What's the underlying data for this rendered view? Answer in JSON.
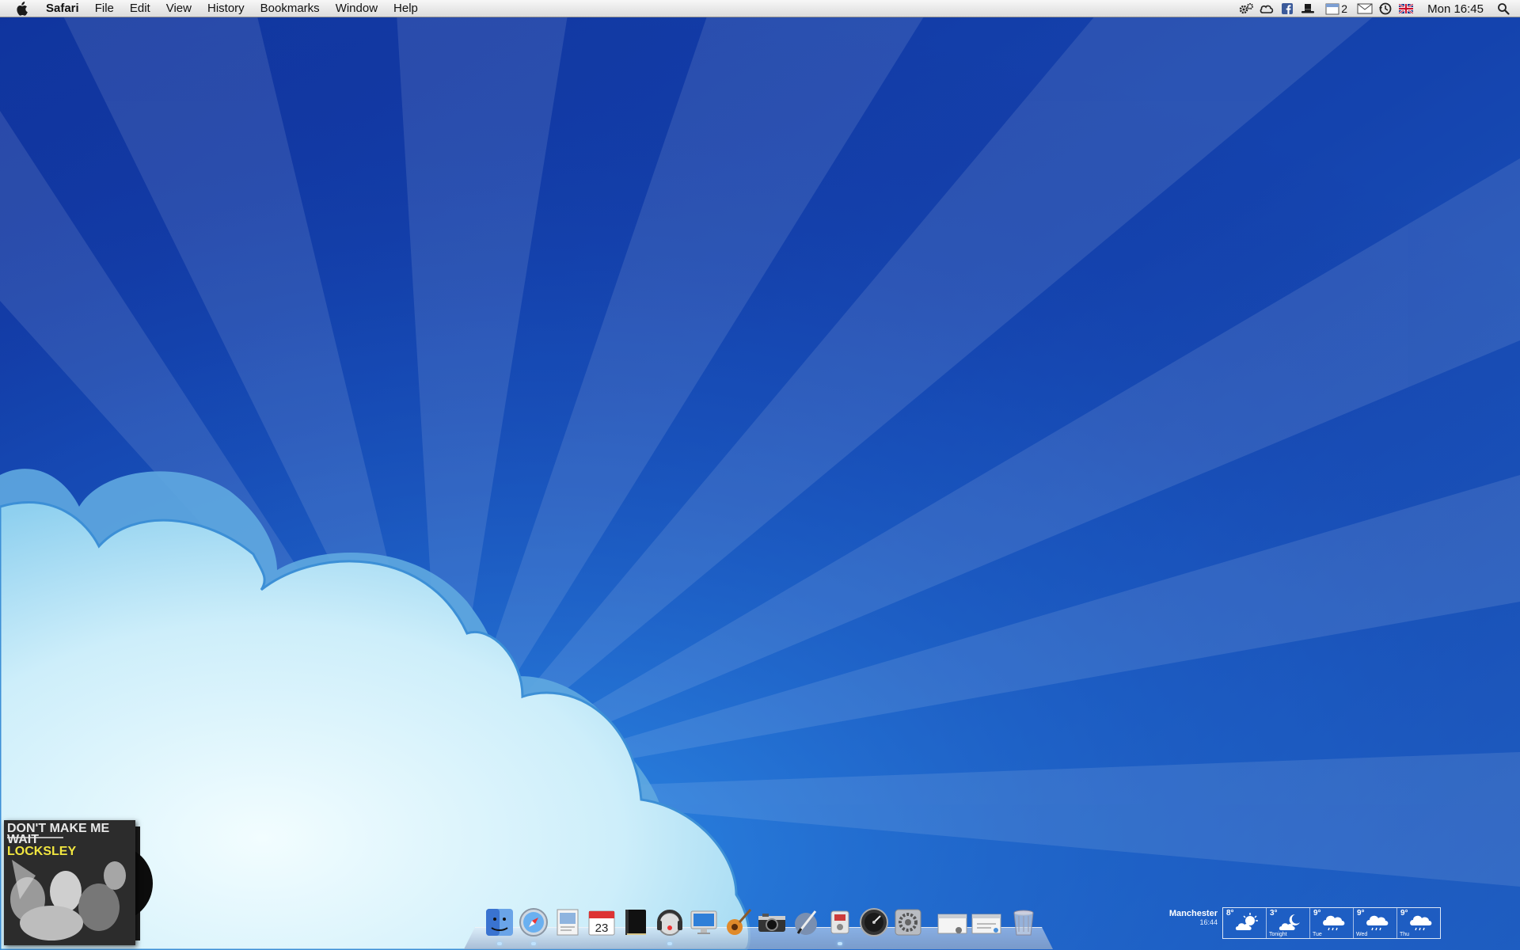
{
  "menubar": {
    "apple_icon": "apple-icon",
    "app_name": "Safari",
    "menus": [
      "File",
      "Edit",
      "View",
      "History",
      "Bookmarks",
      "Window",
      "Help"
    ],
    "extras": [
      "gears-icon",
      "cloud-icon",
      "facebook-icon",
      "hat-icon",
      "calendar-icon",
      "mail-icon",
      "time-machine-icon",
      "uk-flag-icon"
    ],
    "calendar_badge": "2",
    "clock": "Mon 16:45",
    "spotlight_icon": "spotlight-icon"
  },
  "album_widget": {
    "line1": "DON'T MAKE ME",
    "line2": "WAIT",
    "line3": "LOCKSLEY",
    "accent_color": "#f1e640"
  },
  "dock": {
    "apps": [
      "finder-icon",
      "safari-icon",
      "preview-icon",
      "ical-icon",
      "notebook-icon",
      "itunes-icon",
      "display-icon",
      "garageband-icon",
      "camera-icon",
      "pen-icon",
      "utility-icon",
      "dashboard-gauge-icon",
      "system-preferences-icon",
      "window-stack-icon",
      "window-stack-icon-2",
      "trash-icon"
    ],
    "ical_date": "23"
  },
  "weather": {
    "city": "Manchester",
    "time": "16:44",
    "days": [
      {
        "temp": "8°",
        "label": "",
        "icon": "sun-cloud-icon"
      },
      {
        "temp": "3°",
        "label": "Tonight",
        "icon": "moon-cloud-icon"
      },
      {
        "temp": "9°",
        "label": "Tue",
        "icon": "rain-cloud-icon"
      },
      {
        "temp": "9°",
        "label": "Wed",
        "icon": "rain-cloud-icon"
      },
      {
        "temp": "9°",
        "label": "Thu",
        "icon": "rain-cloud-icon"
      }
    ]
  },
  "colors": {
    "sky_dark": "#0e1f8c",
    "sky_mid": "#1a5cc8",
    "sky_light": "#2a8ae6",
    "cloud": "#cdeefa"
  }
}
